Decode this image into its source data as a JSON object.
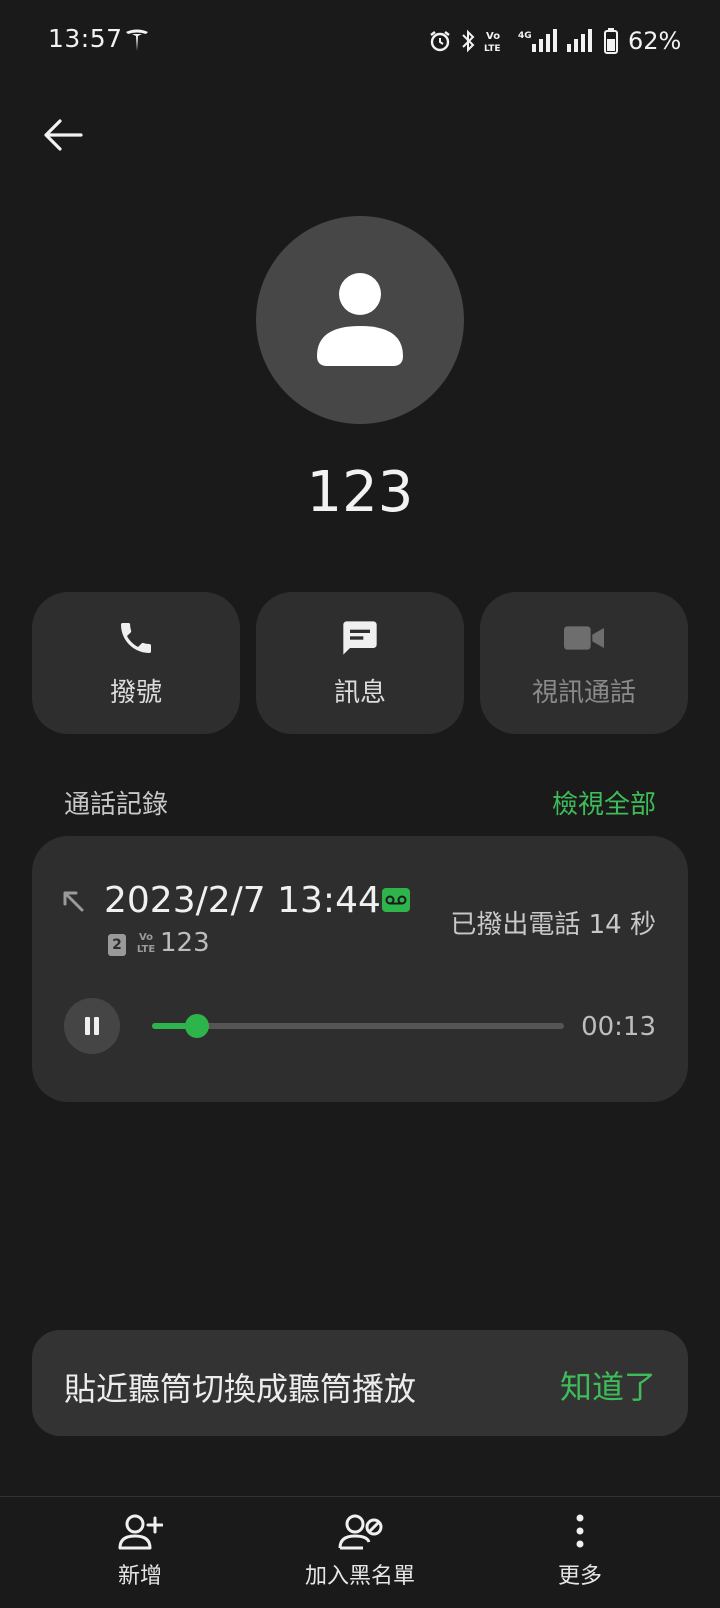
{
  "status_bar": {
    "time": "13:57",
    "battery": "62%",
    "icons": [
      "tesla-icon",
      "alarm-icon",
      "bluetooth-icon",
      "volte-icon",
      "4g-signal-icon",
      "signal-icon",
      "battery-icon"
    ]
  },
  "contact": {
    "name": "123"
  },
  "actions": [
    {
      "label": "撥號",
      "icon": "phone-icon"
    },
    {
      "label": "訊息",
      "icon": "message-icon"
    },
    {
      "label": "視訊通話",
      "icon": "video-call-icon"
    }
  ],
  "call_log": {
    "title": "通話記錄",
    "view_all": "檢視全部",
    "entry": {
      "datetime": "2023/2/7 13:44",
      "status": "已撥出電話  14 秒",
      "sim": "2",
      "number": "123",
      "playback_time": "00:13",
      "progress": 0.11
    }
  },
  "snackbar": {
    "text": "貼近聽筒切換成聽筒播放",
    "action": "知道了"
  },
  "bottom_nav": [
    {
      "label": "新增",
      "icon": "add-contact-icon"
    },
    {
      "label": "加入黑名單",
      "icon": "block-contact-icon"
    },
    {
      "label": "更多",
      "icon": "more-vert-icon"
    }
  ],
  "colors": {
    "background": "#1a1a1a",
    "card": "#2e2e2e",
    "accent": "#3ebc5a"
  }
}
